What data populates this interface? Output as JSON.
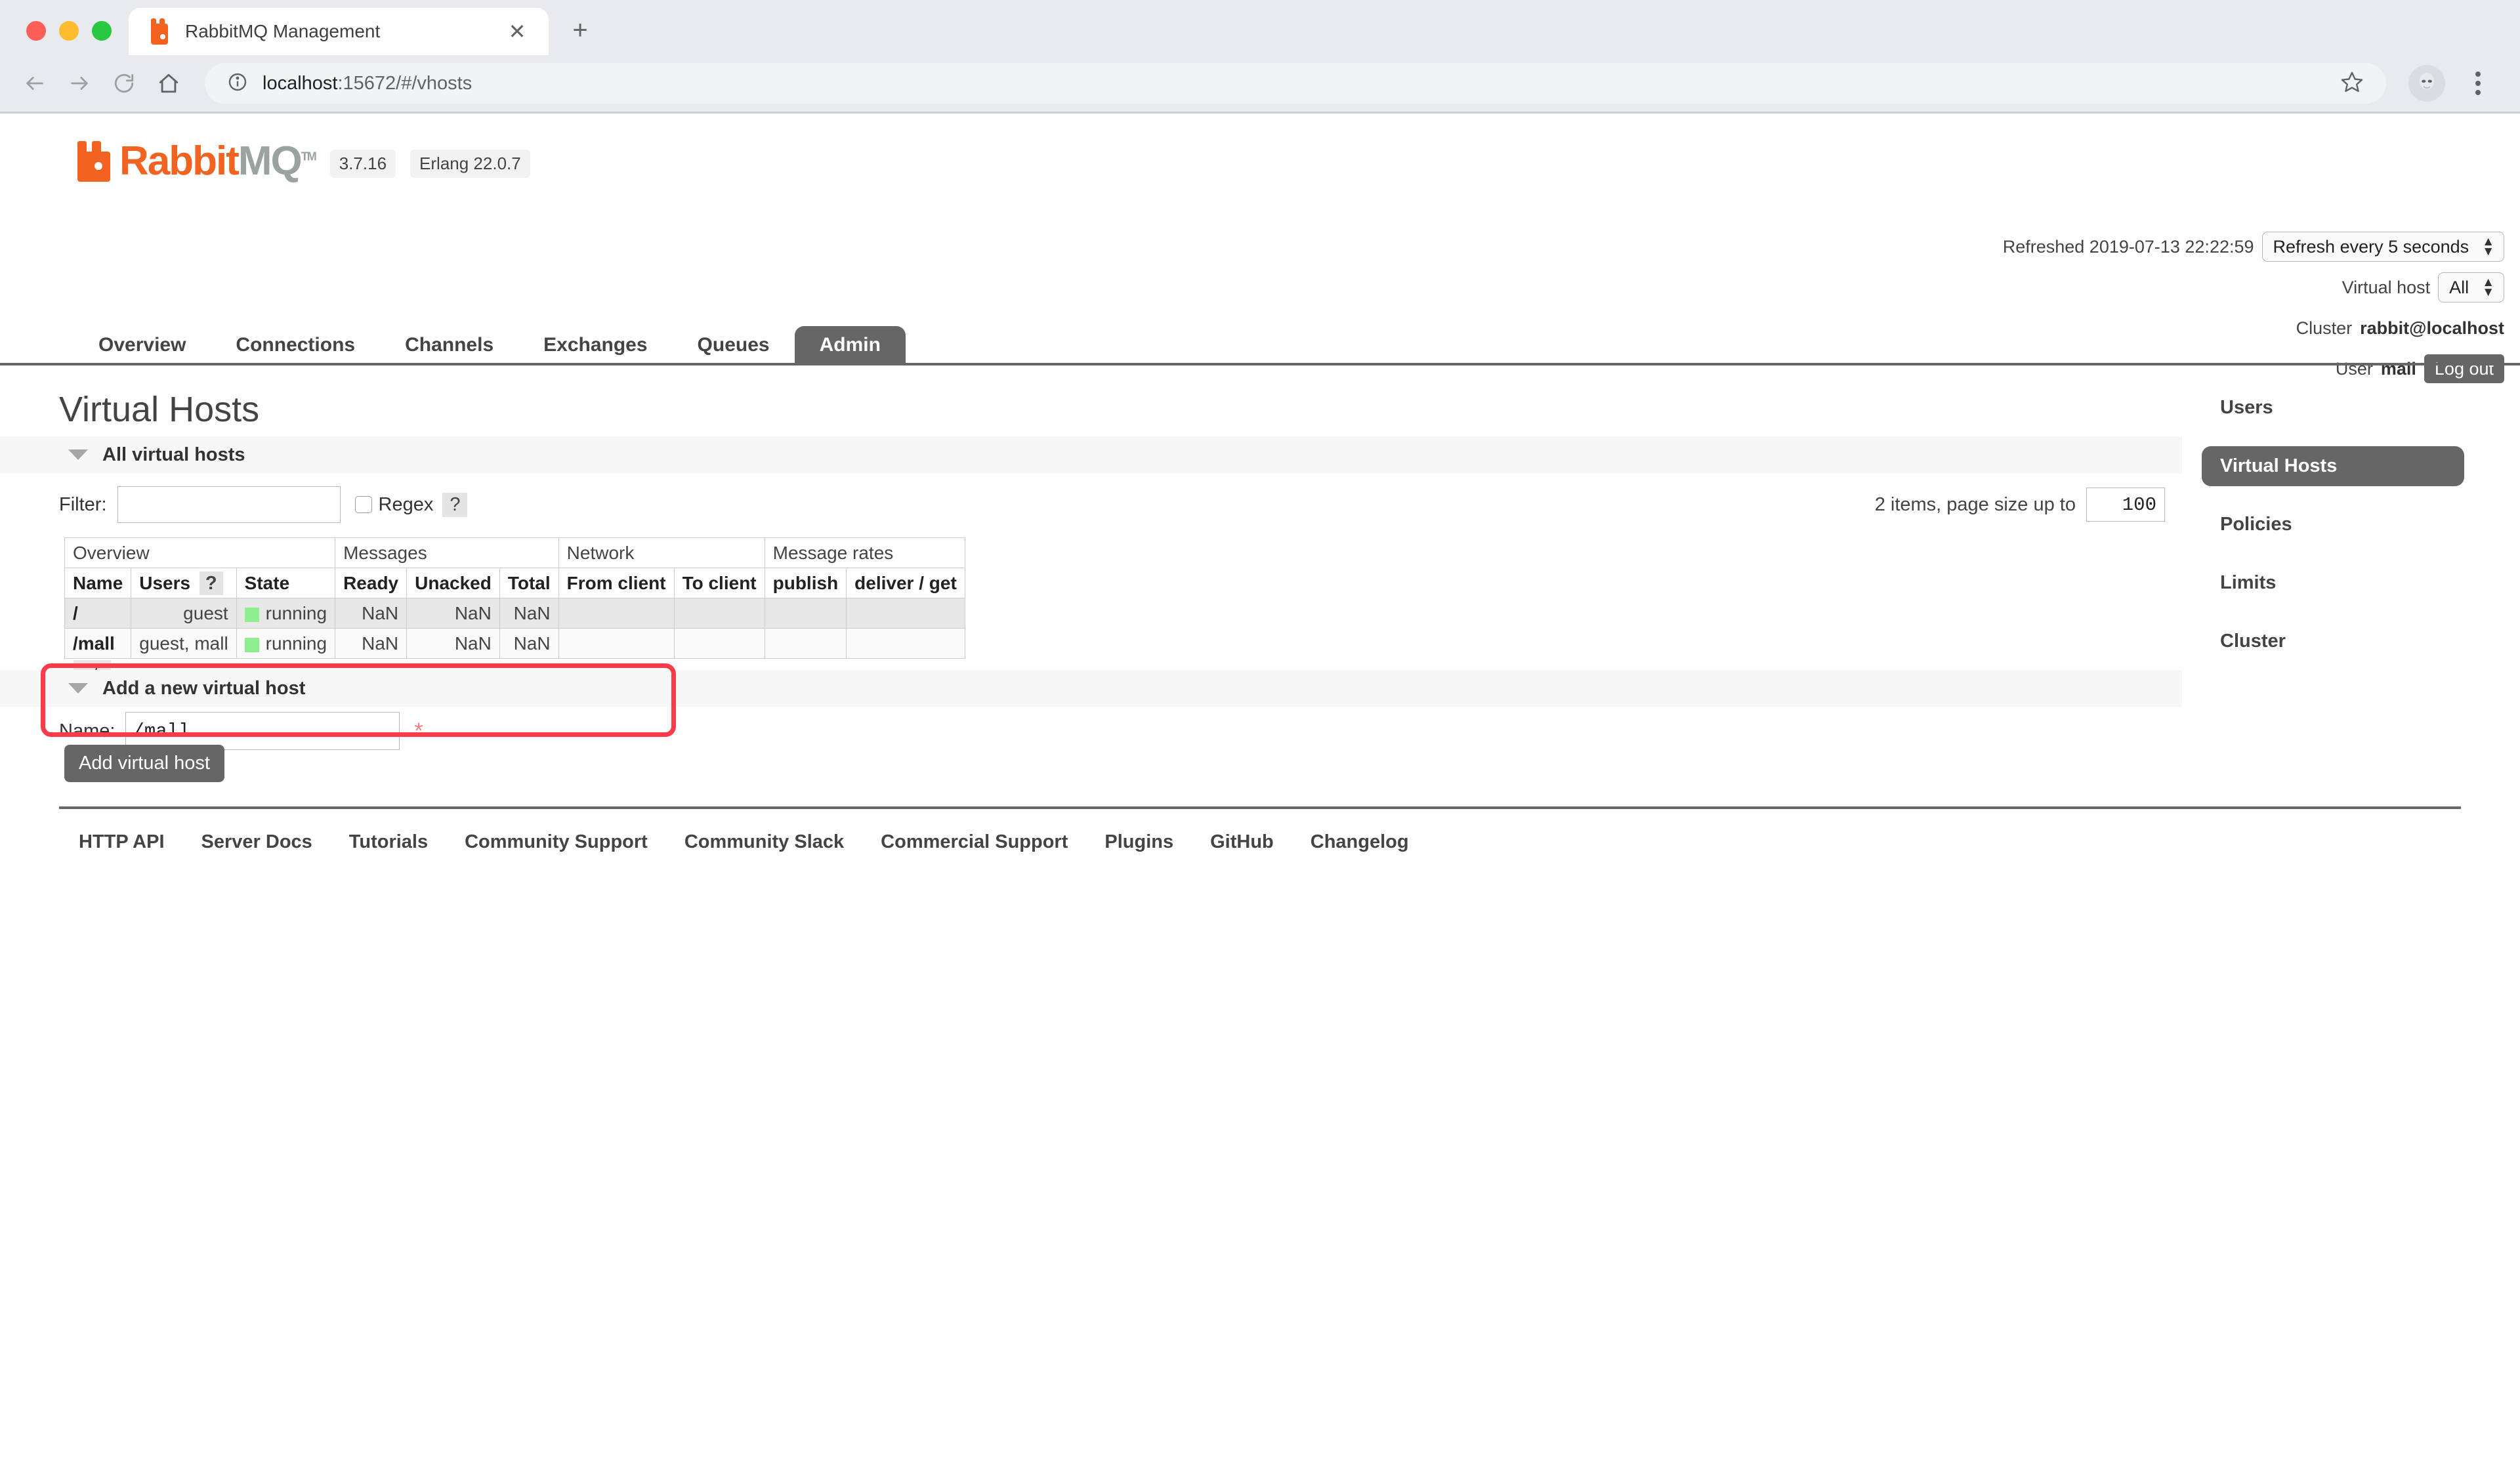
{
  "browser": {
    "tab_title": "RabbitMQ Management",
    "tab_close_label": "✕",
    "new_tab_label": "+",
    "url_text_bold": "localhost",
    "url_text_rest": ":15672/#/vhosts",
    "back_icon": "back-arrow-icon",
    "forward_icon": "forward-arrow-icon",
    "reload_icon": "reload-icon",
    "home_icon": "home-icon",
    "info_icon": "site-info-icon",
    "star_icon": "bookmark-star-icon",
    "profile_icon": "profile-avatar-icon",
    "menu_icon": "three-dot-menu-icon"
  },
  "header": {
    "logo_rabbit": "Rabbit",
    "logo_mq": "MQ",
    "logo_tm": "TM",
    "version": "3.7.16",
    "erlang": "Erlang 22.0.7",
    "refreshed_label": "Refreshed 2019-07-13 22:22:59",
    "refresh_select": "Refresh every 5 seconds",
    "vhost_label": "Virtual host",
    "vhost_select": "All",
    "cluster_label": "Cluster",
    "cluster_name": "rabbit@localhost",
    "user_label": "User",
    "user_name": "mall",
    "logout_label": "Log out"
  },
  "nav": {
    "tabs": [
      {
        "label": "Overview",
        "active": false
      },
      {
        "label": "Connections",
        "active": false
      },
      {
        "label": "Channels",
        "active": false
      },
      {
        "label": "Exchanges",
        "active": false
      },
      {
        "label": "Queues",
        "active": false
      },
      {
        "label": "Admin",
        "active": true
      }
    ]
  },
  "main": {
    "page_title": "Virtual Hosts",
    "all_vhosts_section": "All virtual hosts",
    "filter_label": "Filter:",
    "filter_value": "",
    "filter_placeholder": "",
    "regex_label": "Regex",
    "regex_help": "?",
    "paging_text": "2 items, page size up to",
    "page_size_value": "100",
    "plusminus_label": "+/-",
    "users_help": "?"
  },
  "table": {
    "group_headers": [
      {
        "label": "Overview",
        "colspan": 3
      },
      {
        "label": "Messages",
        "colspan": 3
      },
      {
        "label": "Network",
        "colspan": 2
      },
      {
        "label": "Message rates",
        "colspan": 2
      }
    ],
    "columns": [
      "Name",
      "Users",
      "State",
      "Ready",
      "Unacked",
      "Total",
      "From client",
      "To client",
      "publish",
      "deliver / get"
    ],
    "rows": [
      {
        "name": "/",
        "users": "guest",
        "state": "running",
        "state_color": "#90ee90",
        "ready": "NaN",
        "unacked": "NaN",
        "total": "NaN",
        "from_client": "",
        "to_client": "",
        "publish": "",
        "deliver_get": ""
      },
      {
        "name": "/mall",
        "users": "guest, mall",
        "state": "running",
        "state_color": "#90ee90",
        "ready": "NaN",
        "unacked": "NaN",
        "total": "NaN",
        "from_client": "",
        "to_client": "",
        "publish": "",
        "deliver_get": ""
      }
    ]
  },
  "add_form": {
    "section_title": "Add a new virtual host",
    "name_label": "Name:",
    "name_value": "/mall",
    "required_marker": "*",
    "submit_label": "Add virtual host",
    "highlight_color": "#f93b4a"
  },
  "sidebar": {
    "items": [
      {
        "label": "Users",
        "active": false
      },
      {
        "label": "Virtual Hosts",
        "active": true
      },
      {
        "label": "Policies",
        "active": false
      },
      {
        "label": "Limits",
        "active": false
      },
      {
        "label": "Cluster",
        "active": false
      }
    ]
  },
  "footer": {
    "links": [
      "HTTP API",
      "Server Docs",
      "Tutorials",
      "Community Support",
      "Community Slack",
      "Commercial Support",
      "Plugins",
      "GitHub",
      "Changelog"
    ]
  },
  "colors": {
    "brand_orange": "#f26322",
    "ui_gray": "#666666",
    "status_green": "#90ee90"
  }
}
